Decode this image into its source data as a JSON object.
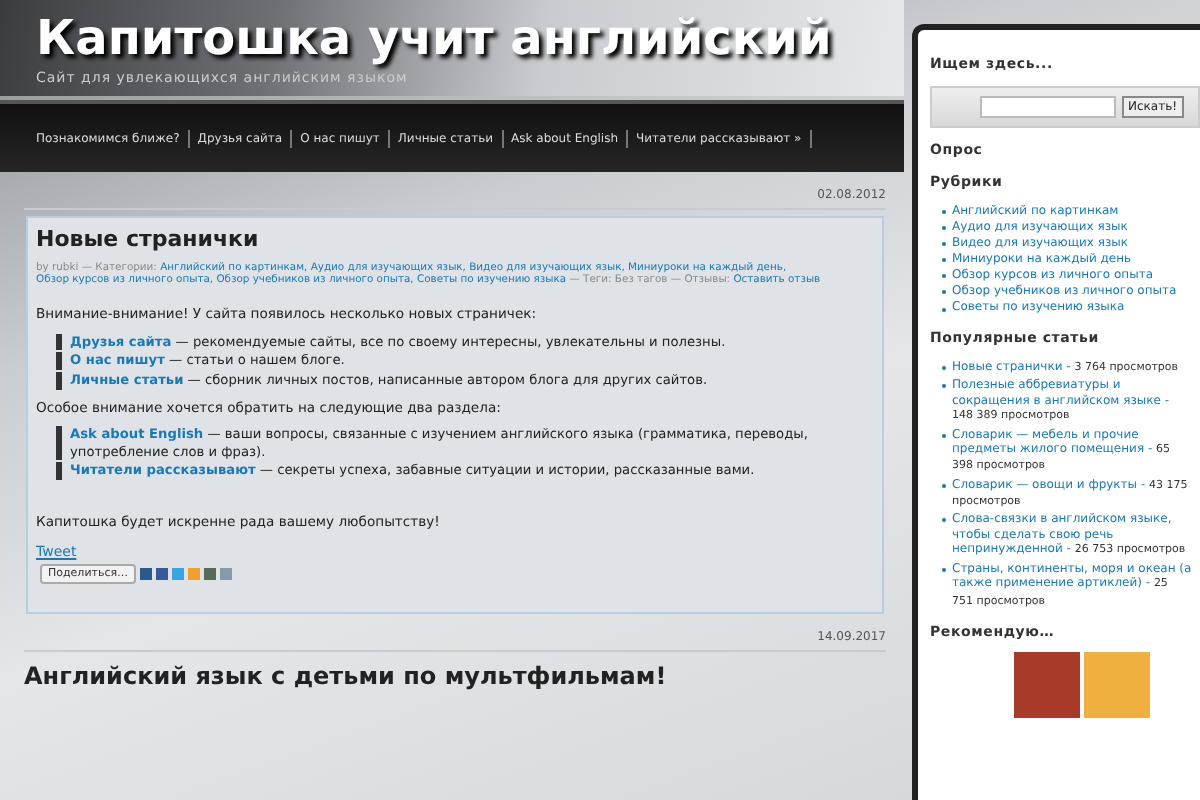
{
  "site": {
    "title": "Капитошка учит английский",
    "tagline": "Сайт для увлекающихся английским языком"
  },
  "nav": [
    "Познакомимся ближе?",
    "Друзья сайта",
    "О нас пишут",
    "Личные статьи",
    "Ask about English",
    "Читатели рассказывают »"
  ],
  "posts": [
    {
      "date": "02.08.2012",
      "title": "Новые странички",
      "meta": [
        {
          "kind": "plain",
          "text": "by rubki — Категории:"
        },
        {
          "kind": "link",
          "text": "Английский по картинкам,"
        },
        {
          "kind": "link",
          "text": "Аудио для изучающих язык,"
        },
        {
          "kind": "link",
          "text": "Видео для изучающих язык,"
        },
        {
          "kind": "link",
          "text": "Миниуроки на каждый день,"
        },
        {
          "kind": "link",
          "text": "Обзор курсов из личного опыта,"
        },
        {
          "kind": "link",
          "text": "Обзор учебников из личного опыта,"
        },
        {
          "kind": "link",
          "text": "Советы по изучению языка"
        },
        {
          "kind": "plain",
          "text": "— Теги: Без тагов — Отзывы:"
        },
        {
          "kind": "link",
          "text": "Оставить отзыв"
        }
      ],
      "blocks": [
        {
          "kind": "para",
          "text": "Внимание-внимание! У сайта появилось несколько новых страничек:"
        },
        {
          "kind": "quote",
          "items": [
            {
              "link": "Друзья сайта",
              "text": "— рекомендуемые сайты, все по своему интересны, увлекательны и полезны."
            },
            {
              "link": "О нас пишут",
              "text": "— статьи о нашем блоге."
            },
            {
              "link": "Личные статьи",
              "text": "— сборник личных постов, написанные автором блога для других сайтов."
            }
          ]
        },
        {
          "kind": "para",
          "text": "Особое внимание хочется обратить на следующие два раздела:"
        },
        {
          "kind": "quote",
          "items": [
            {
              "link": "Ask about English",
              "text": "— ваши вопросы, связанные с изучением английского языка (грамматика, переводы, употребление слов и фраз)."
            },
            {
              "link": "Читатели рассказывают",
              "text": "— секреты успеха, забавные ситуации и истории, рассказанные вами."
            }
          ]
        },
        {
          "kind": "gap"
        },
        {
          "kind": "para",
          "text": "Капитошка будет искренне рада вашему любопытству!"
        }
      ],
      "tweet": "Tweet",
      "share": "Поделиться…"
    },
    {
      "date": "14.09.2017",
      "title": "Английский язык с детьми по мультфильмам!"
    }
  ],
  "sidebar": {
    "search_heading": "Ищем здесь...",
    "search_button": "Искать!",
    "poll_heading": "Опрос",
    "categories_heading": "Рубрики",
    "categories": [
      "Английский по картинкам",
      "Аудио для изучающих язык",
      "Видео для изучающих язык",
      "Миниуроки на каждый день",
      "Обзор курсов из личного опыта",
      "Обзор учебников из личного опыта",
      "Советы по изучению языка"
    ],
    "popular_heading": "Популярные статьи",
    "popular": [
      {
        "title": "Новые странички -",
        "views": "3 764 просмотров"
      },
      {
        "title": "Полезные аббревиатуры и сокращения в английском языке -",
        "views": "148 389 просмотров"
      },
      {
        "title": "Словарик — мебель и прочие предметы жилого помещения -",
        "views": "65 398 просмотров"
      },
      {
        "title": "Словарик — овощи и фрукты -",
        "views": "43 175 просмотров"
      },
      {
        "title": "Слова-связки в английском языке, чтобы сделать свою речь непринужденной -",
        "views": "26 753 просмотров"
      },
      {
        "title": "Страны, континенты, моря и океан (а также применение артиклей) -",
        "views": "25 751 просмотров"
      }
    ],
    "recommend_heading": "Рекомендую…"
  }
}
